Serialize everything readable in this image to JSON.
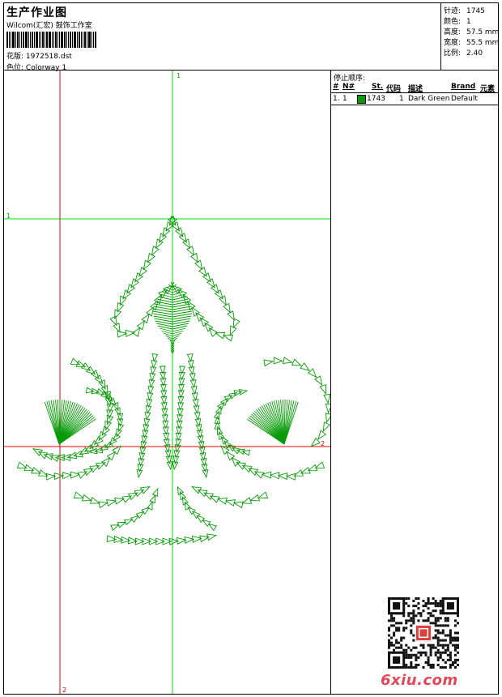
{
  "header": {
    "title": "生产作业图",
    "company": "Wilcom(汇宏) 鼓饰工作室",
    "design_label": "花版:",
    "design_value": "1972518.dst",
    "colorway_label": "色位:",
    "colorway_value": "Colorway 1"
  },
  "stats": [
    {
      "label": "针迹:",
      "value": "1745"
    },
    {
      "label": "颜色:",
      "value": "1"
    },
    {
      "label": "高度:",
      "value": "57.5 mm"
    },
    {
      "label": "宽度:",
      "value": "55.5 mm"
    },
    {
      "label": "比例:",
      "value": "2.40"
    }
  ],
  "stop_sequence": {
    "title": "停止顺序:",
    "columns": [
      "#",
      "N#",
      "St.",
      "代码",
      "描述",
      "Brand",
      "元素"
    ],
    "rows": [
      {
        "index": "1.",
        "needle": "1",
        "stitches": "1743",
        "code": "1",
        "description": "Dark Green",
        "brand": "Default",
        "swatch_color": "#079a07"
      }
    ]
  },
  "canvas": {
    "axis_labels": [
      "1",
      "1",
      "2",
      "2"
    ],
    "guide_color_green": "#00dd00",
    "guide_color_red": "#ee0000",
    "stitch_color": "#079a07"
  },
  "watermark": "6xiu.com"
}
